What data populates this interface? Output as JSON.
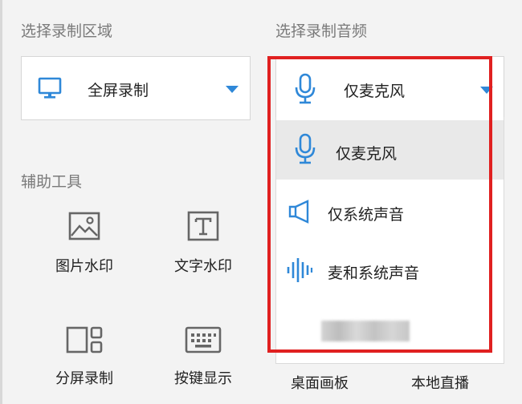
{
  "record_area": {
    "label": "选择录制区域",
    "selected": "全屏录制"
  },
  "record_audio": {
    "label": "选择录制音频",
    "selected": "仅麦克风",
    "options": [
      {
        "label": "仅麦克风",
        "icon": "microphone-icon",
        "selected": true
      },
      {
        "label": "仅系统声音",
        "icon": "speaker-icon",
        "selected": false
      },
      {
        "label": "麦和系统声音",
        "icon": "waveform-icon",
        "selected": false
      }
    ]
  },
  "tools": {
    "label": "辅助工具",
    "items": [
      {
        "label": "图片水印",
        "icon": "image-icon"
      },
      {
        "label": "文字水印",
        "icon": "text-t-icon"
      },
      {
        "label": "分屏录制",
        "icon": "split-screen-icon"
      },
      {
        "label": "按键显示",
        "icon": "keyboard-icon"
      },
      {
        "label": "桌面画板",
        "icon": "whiteboard-icon"
      },
      {
        "label": "本地直播",
        "icon": "live-icon"
      }
    ]
  },
  "colors": {
    "accent": "#2f88d8",
    "highlight": "#e02020",
    "selected_bg": "#e9e9e9"
  }
}
